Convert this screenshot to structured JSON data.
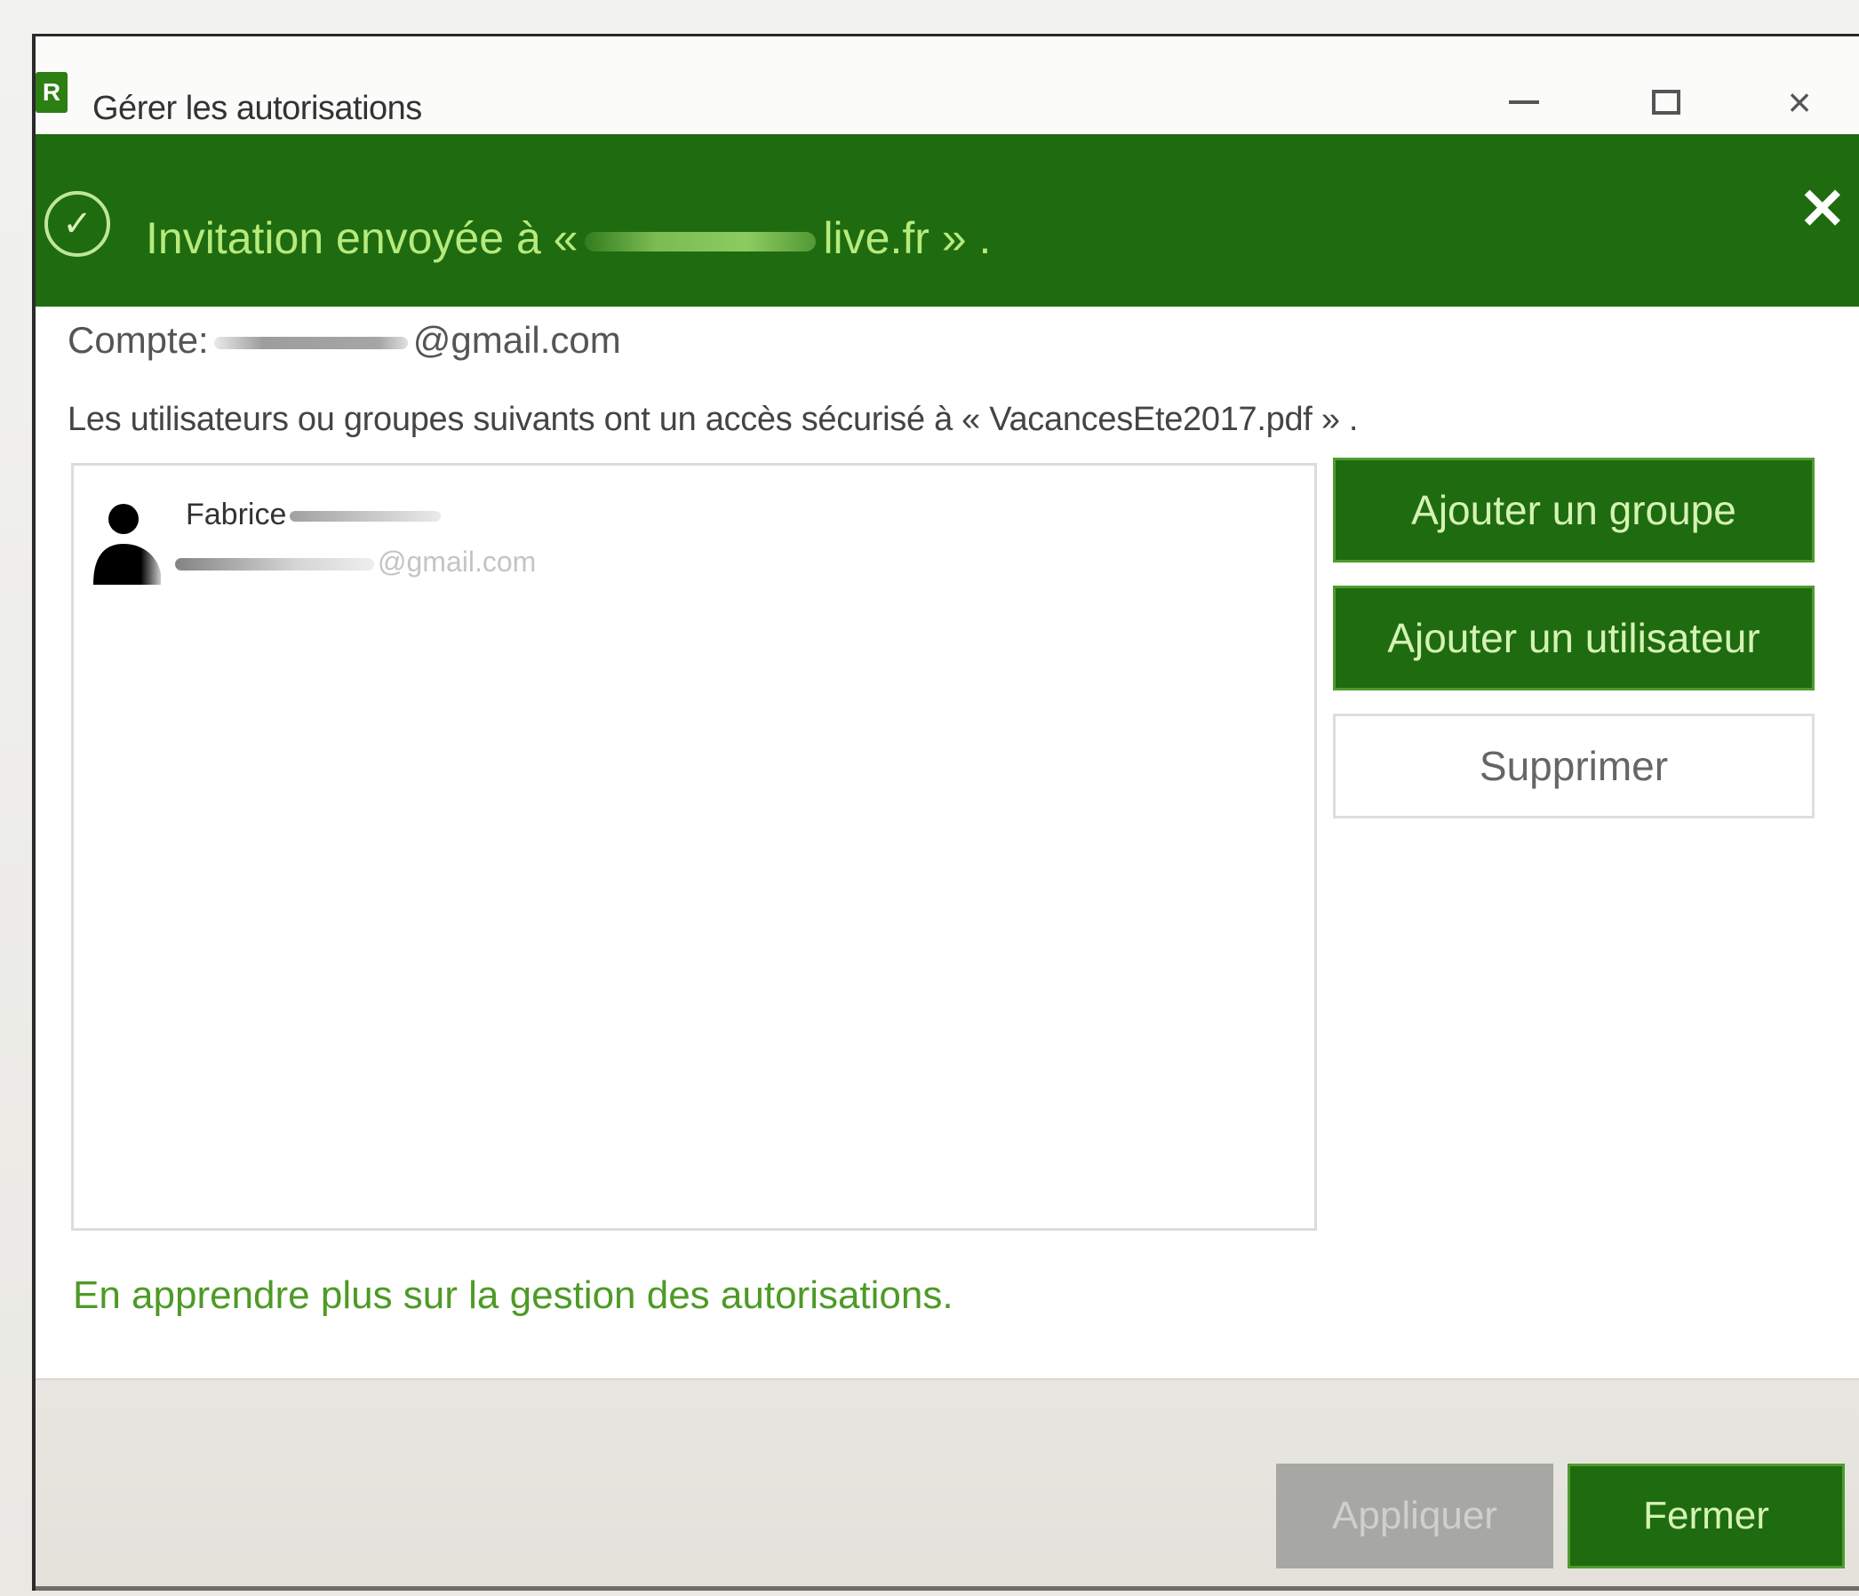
{
  "window": {
    "title": "Gérer les autorisations",
    "app_icon_glyph": "R",
    "app_icon_name": "app-icon",
    "minimize_icon": "minimize-icon",
    "maximize_icon": "maximize-icon",
    "close_icon": "close-icon",
    "close_glyph": "×"
  },
  "banner": {
    "prefix": "Invitation envoyée à «",
    "suffix": "live.fr » .",
    "check_glyph": "✓",
    "close_glyph": "✕",
    "background": "#1f6b0f",
    "text_color": "#b6ea7c"
  },
  "account": {
    "label": "Compte:",
    "domain": "@gmail.com"
  },
  "description": "Les utilisateurs ou groupes suivants ont un accès sécurisé à « VacancesEte2017.pdf » .",
  "users": [
    {
      "name": "Fabrice",
      "email_suffix": "@gmail.com"
    }
  ],
  "actions": {
    "add_group": "Ajouter un groupe",
    "add_user": "Ajouter un utilisateur",
    "delete": "Supprimer"
  },
  "learn_more": "En apprendre plus sur la gestion des autorisations.",
  "footer": {
    "apply": "Appliquer",
    "close": "Fermer"
  },
  "colors": {
    "accent": "#1f6b0f",
    "link": "#4e9a26",
    "disabled": "#a7a7a4"
  }
}
